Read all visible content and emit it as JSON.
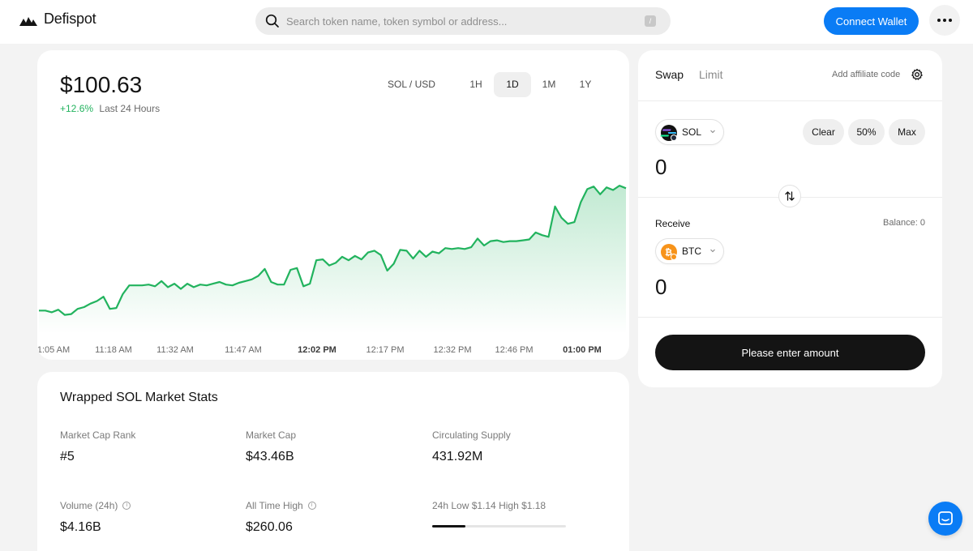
{
  "header": {
    "brand": "Defispot",
    "search_placeholder": "Search token name, token symbol or address...",
    "search_value": "",
    "search_shortcut": "/",
    "connect_label": "Connect Wallet"
  },
  "chart_card": {
    "price": "$100.63",
    "change_pct": "+12.6%",
    "change_period": "Last 24 Hours",
    "pair": "SOL / USD",
    "timeframes": [
      "1H",
      "1D",
      "1M",
      "1Y"
    ],
    "active_timeframe": "1D"
  },
  "chart_data": {
    "type": "area",
    "title": "",
    "xlabel": "",
    "ylabel": "",
    "x_tick_labels": [
      "1:05 AM",
      "11:18 AM",
      "11:32 AM",
      "11:47 AM",
      "12:02 PM",
      "12:17 PM",
      "12:32 PM",
      "12:46 PM",
      "01:00 PM"
    ],
    "bold_ticks": [
      "12:02 PM",
      "01:00 PM"
    ],
    "series_color": "#22b35e",
    "series": [
      {
        "name": "",
        "values": [
          89.5,
          89.5,
          89.3,
          89.6,
          89.0,
          89.1,
          89.7,
          89.9,
          90.3,
          90.6,
          91.1,
          89.7,
          89.8,
          91.4,
          92.4,
          92.4,
          92.4,
          92.5,
          92.3,
          92.9,
          92.2,
          92.6,
          92.0,
          92.6,
          92.2,
          92.5,
          92.4,
          92.6,
          92.8,
          92.5,
          92.4,
          92.7,
          92.9,
          93.1,
          93.5,
          94.3,
          92.8,
          92.5,
          92.5,
          94.2,
          94.4,
          92.3,
          92.6,
          95.3,
          95.4,
          94.7,
          95.0,
          95.7,
          95.3,
          95.8,
          95.4,
          96.2,
          96.4,
          95.9,
          94.1,
          94.9,
          96.5,
          96.4,
          95.5,
          96.4,
          95.7,
          96.3,
          96.1,
          96.7,
          96.6,
          96.7,
          96.6,
          96.8,
          97.8,
          97.0,
          97.5,
          97.6,
          97.4,
          97.5,
          97.5,
          97.6,
          97.7,
          98.5,
          98.2,
          98.0,
          101.5,
          100.2,
          99.5,
          99.7,
          102.0,
          103.5,
          103.8,
          102.9,
          103.7,
          103.4,
          103.9,
          103.6
        ],
        "last_value": 100.63
      }
    ]
  },
  "stats": {
    "title": "Wrapped SOL Market Stats",
    "items": [
      {
        "label": "Market Cap Rank",
        "value": "#5"
      },
      {
        "label": "Market Cap",
        "value": "$43.46B"
      },
      {
        "label": "Circulating Supply",
        "value": "431.92M"
      },
      {
        "label": "Volume (24h)",
        "value": "$4.16B"
      },
      {
        "label": "All Time High",
        "value": "$260.06"
      },
      {
        "label": "24h Low $1.14 High $1.18",
        "value": ""
      }
    ],
    "range_progress": 0.25
  },
  "swap": {
    "tab_swap": "Swap",
    "tab_limit": "Limit",
    "affiliate": "Add affiliate code",
    "from_token": "SOL",
    "chip_clear": "Clear",
    "chip_half": "50%",
    "chip_max": "Max",
    "from_amount": "0",
    "receive_label": "Receive",
    "balance": "Balance: 0",
    "to_token": "BTC",
    "to_amount": "0",
    "cta": "Please enter amount"
  },
  "colors": {
    "accent": "#0a7cf5",
    "up": "#22b35e",
    "dark": "#141414"
  }
}
